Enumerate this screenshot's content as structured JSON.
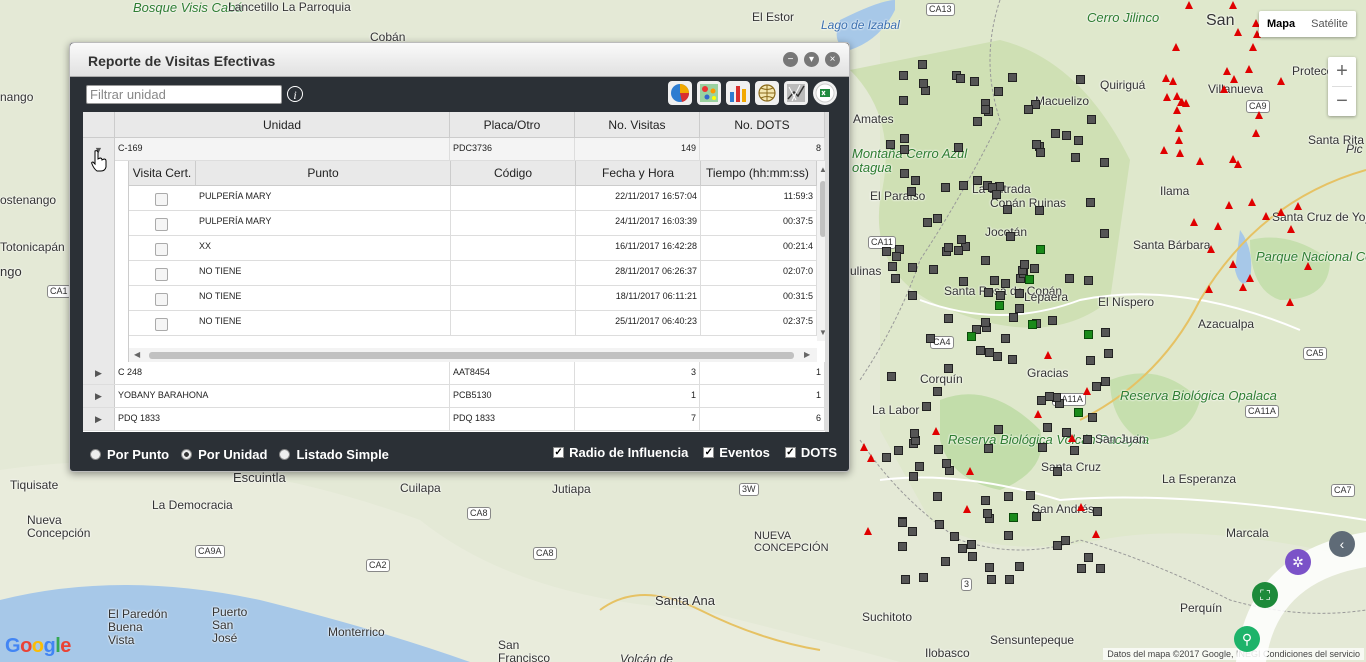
{
  "map": {
    "map_type_tabs": [
      "Mapa",
      "Satélite"
    ],
    "active_map_type": "Mapa",
    "zoom_in": "+",
    "zoom_out": "−",
    "attribution": "Datos del mapa ©2017 Google, INEGI   Condiciones del servicio",
    "google_logo": "Google",
    "places": [
      {
        "name": "Bosque Visis Cabá",
        "cls": "green"
      },
      {
        "name": "Lancetillo La Parroquia"
      },
      {
        "name": "El Estor"
      },
      {
        "name": "Lago de Izabal",
        "cls": "water"
      },
      {
        "name": "Cerro Jilinco",
        "cls": "green"
      },
      {
        "name": "San"
      },
      {
        "name": "Quiriguá"
      },
      {
        "name": "Macuelizo"
      },
      {
        "name": "Amates"
      },
      {
        "name": "Protección"
      },
      {
        "name": "Villanueva"
      },
      {
        "name": "Santa Rita"
      },
      {
        "name": "Montaña Cerro Azul",
        "cls": "green"
      },
      {
        "name": "El Paraíso"
      },
      {
        "name": "Ilama"
      },
      {
        "name": "Santa Cruz de Yojoa"
      },
      {
        "name": "Santa Bárbara"
      },
      {
        "name": "Parque Nacional Cerro Azul Meámbar",
        "cls": "green"
      },
      {
        "name": "El Níspero"
      },
      {
        "name": "Santa Rosa de Copán"
      },
      {
        "name": "La Entrada"
      },
      {
        "name": "Lepaera"
      },
      {
        "name": "Azacualpa"
      },
      {
        "name": "Corquín"
      },
      {
        "name": "Gracias"
      },
      {
        "name": "La Labor"
      },
      {
        "name": "Reserva Biológica Opalaca",
        "cls": "green"
      },
      {
        "name": "Reserva Biológica Volcán Pacayita",
        "cls": "green"
      },
      {
        "name": "San Juan"
      },
      {
        "name": "Santa Cruz"
      },
      {
        "name": "La Esperanza"
      },
      {
        "name": "San Andrés"
      },
      {
        "name": "Marcala"
      },
      {
        "name": "Escuintla"
      },
      {
        "name": "Cuilapa"
      },
      {
        "name": "Jutiapa"
      },
      {
        "name": "Tiquisate"
      },
      {
        "name": "La Democracia"
      },
      {
        "name": "Nueva Concepción"
      },
      {
        "name": "NUEVA CONCEPCIÓN"
      },
      {
        "name": "Santa Ana"
      },
      {
        "name": "El Paredón Buena Vista"
      },
      {
        "name": "Puerto San José"
      },
      {
        "name": "Monterrico"
      },
      {
        "name": "San Francisco Menéndez"
      },
      {
        "name": "Suchitoto"
      },
      {
        "name": "Sensuntepeque"
      },
      {
        "name": "Perquín"
      },
      {
        "name": "Ilobasco"
      },
      {
        "name": "Totonicapán"
      },
      {
        "name": "nango"
      },
      {
        "name": "ostenango"
      },
      {
        "name": "ngo"
      },
      {
        "name": "otagua",
        "cls": "green"
      },
      {
        "name": "Jocotán"
      },
      {
        "name": "Copán Ruinas"
      },
      {
        "name": "ulinas"
      },
      {
        "name": "Cobán"
      },
      {
        "name": "Volcán de"
      },
      {
        "name": "Pic"
      }
    ],
    "roads": [
      "CA13",
      "CA9",
      "CA11",
      "CA4",
      "CA5",
      "CA11A",
      "CA11A",
      "CA1",
      "CA8",
      "CA8",
      "CA9A",
      "CA2",
      "3W",
      "3",
      "CA7"
    ]
  },
  "dialog": {
    "title": "Reporte de Visitas Efectivas",
    "filter_placeholder": "Filtrar unidad",
    "info_glyph": "i",
    "tools": [
      "pie-chart-icon",
      "heatmap-icon",
      "bar-chart-icon",
      "globe-grid-icon",
      "route-map-icon",
      "excel-export-icon"
    ],
    "columns": [
      "Unidad",
      "Placa/Otro",
      "No. Visitas",
      "No. DOTS"
    ],
    "expanded_row": {
      "unidad": "C-169",
      "placa": "PDC3736",
      "visitas": "149",
      "dots": "8"
    },
    "detail_columns": [
      "Visita Cert.",
      "Punto",
      "Código",
      "Fecha y Hora",
      "Tiempo (hh:mm:ss)"
    ],
    "detail_rows": [
      {
        "punto": "PULPERÍA MARY",
        "codigo": "",
        "fecha": "22/11/2017 16:57:04",
        "tiempo": "11:59:3"
      },
      {
        "punto": "PULPERÍA MARY",
        "codigo": "",
        "fecha": "24/11/2017 16:03:39",
        "tiempo": "00:37:5"
      },
      {
        "punto": "XX",
        "codigo": "",
        "fecha": "16/11/2017 16:42:28",
        "tiempo": "00:21:4"
      },
      {
        "punto": "NO TIENE",
        "codigo": "",
        "fecha": "28/11/2017 06:26:37",
        "tiempo": "02:07:0"
      },
      {
        "punto": "NO TIENE",
        "codigo": "",
        "fecha": "18/11/2017 06:11:21",
        "tiempo": "00:31:5"
      },
      {
        "punto": "NO TIENE",
        "codigo": "",
        "fecha": "25/11/2017 06:40:23",
        "tiempo": "02:37:5"
      }
    ],
    "rows": [
      {
        "unidad": "C 248",
        "placa": "AAT8454",
        "visitas": "3",
        "dots": "1"
      },
      {
        "unidad": "YOBANY BARAHONA",
        "placa": "PCB5130",
        "visitas": "1",
        "dots": "1"
      },
      {
        "unidad": "PDQ 1833",
        "placa": "PDQ 1833",
        "visitas": "7",
        "dots": "6"
      }
    ],
    "view_options": [
      {
        "label": "Por Punto",
        "selected": false
      },
      {
        "label": "Por Unidad",
        "selected": true
      },
      {
        "label": "Listado Simple",
        "selected": false
      }
    ],
    "layer_options": [
      {
        "label": "Radio de Influencia",
        "checked": true
      },
      {
        "label": "Eventos",
        "checked": true
      },
      {
        "label": "DOTS",
        "checked": true
      }
    ]
  }
}
